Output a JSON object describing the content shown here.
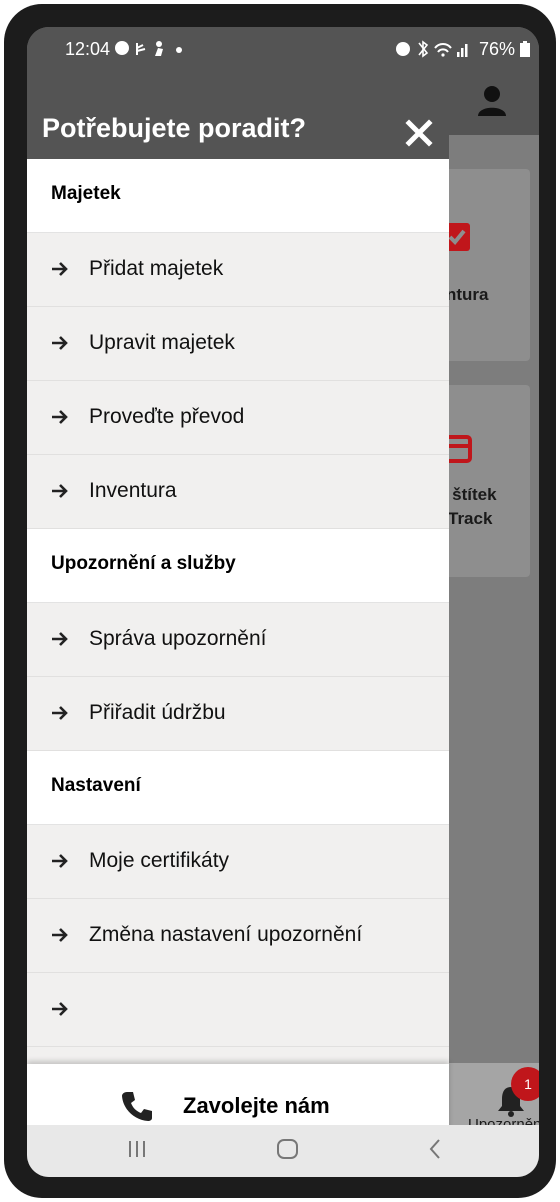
{
  "status_bar": {
    "time": "12:04",
    "left_icons": [
      "facebook-icon",
      "usb-icon",
      "person-icon",
      "dot-icon"
    ],
    "right_icons": [
      "alarm-icon",
      "bluetooth-icon",
      "wifi-icon",
      "signal-icon"
    ],
    "battery": "76%"
  },
  "drawer": {
    "title": "Potřebujete poradit?",
    "sections": [
      {
        "title": "Majetek",
        "items": [
          "Přidat majetek",
          "Upravit majetek",
          "Proveďte převod",
          "Inventura"
        ]
      },
      {
        "title": "Upozornění a služby",
        "items": [
          "Správa upozornění",
          "Přiřadit údržbu"
        ]
      },
      {
        "title": "Nastavení",
        "items": [
          "Moje certifikáty",
          "Změna nastavení upozornění",
          ""
        ]
      }
    ],
    "call_label": "Zavolejte nám"
  },
  "background": {
    "card1_label": "ntura",
    "card2_line1": "ý štítek",
    "card2_line2": "Track",
    "notification_count": "1",
    "notification_label": "Upozornění"
  },
  "colors": {
    "header": "#545454",
    "accent": "#c0161b",
    "item_bg": "#f1f0ef"
  }
}
